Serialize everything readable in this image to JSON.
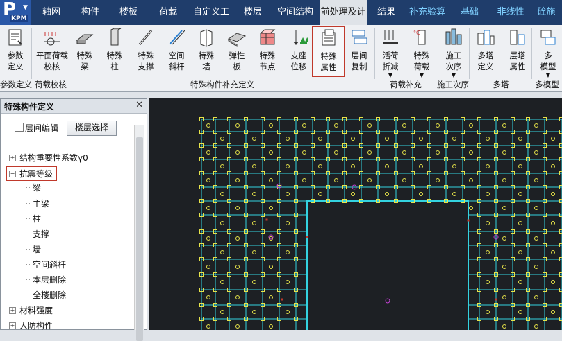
{
  "app": {
    "logo_letter": "P",
    "logo_text": "KPM",
    "logo_menu_icon": "dropdown-arrow-icon"
  },
  "menubar": {
    "items": [
      {
        "label": "轴网"
      },
      {
        "label": "构件"
      },
      {
        "label": "楼板"
      },
      {
        "label": "荷载"
      },
      {
        "label": "自定义工"
      },
      {
        "label": "楼层"
      },
      {
        "label": "空间结构"
      },
      {
        "label": "前处理及计"
      },
      {
        "label": "结果"
      },
      {
        "label": "补充验算"
      },
      {
        "label": "基础"
      },
      {
        "label": "非线性"
      },
      {
        "label": "砼施"
      }
    ],
    "active_index": 7
  },
  "ribbon": {
    "buttons": [
      {
        "label": "参数\n定义",
        "icon": "document-parameters-icon"
      },
      {
        "label": "平面荷载\n校核",
        "icon": "load-check-icon"
      },
      {
        "label": "特殊\n梁",
        "icon": "special-beam-icon"
      },
      {
        "label": "特殊\n柱",
        "icon": "special-column-icon"
      },
      {
        "label": "特殊\n支撑",
        "icon": "special-brace-icon"
      },
      {
        "label": "空间\n斜杆",
        "icon": "space-diagonal-icon"
      },
      {
        "label": "特殊\n墙",
        "icon": "special-wall-icon"
      },
      {
        "label": "弹性\n板",
        "icon": "elastic-slab-icon"
      },
      {
        "label": "特殊\n节点",
        "icon": "special-node-icon"
      },
      {
        "label": "支座\n位移",
        "icon": "support-displacement-icon"
      },
      {
        "label": "特殊\n属性",
        "icon": "special-property-icon"
      },
      {
        "label": "层间\n复制",
        "icon": "layer-copy-icon"
      },
      {
        "label": "活荷\n折减",
        "icon": "live-load-reduction-icon"
      },
      {
        "label": "特殊\n荷载",
        "icon": "special-load-icon"
      },
      {
        "label": "施工\n次序",
        "icon": "construction-order-icon"
      },
      {
        "label": "多塔\n定义",
        "icon": "multi-tower-define-icon"
      },
      {
        "label": "层塔\n属性",
        "icon": "layer-tower-property-icon"
      },
      {
        "label": "多\n模型",
        "icon": "multi-model-icon"
      }
    ],
    "groups": [
      {
        "label": "参数定义"
      },
      {
        "label": "荷载校核"
      },
      {
        "label": "特殊构件补充定义"
      },
      {
        "label": "荷载补充"
      },
      {
        "label": "施工次序"
      },
      {
        "label": "多塔"
      },
      {
        "label": "多模型"
      }
    ],
    "highlight_index": 10
  },
  "panel": {
    "title": "特殊构件定义",
    "close_icon": "close-icon",
    "checkbox_label": "层间编辑",
    "floor_button": "楼层选择",
    "tree": [
      {
        "label": "结构重要性系数γ0",
        "level": 0,
        "toggle": "+"
      },
      {
        "label": "抗震等级",
        "level": 0,
        "toggle": "-",
        "highlight": true
      },
      {
        "label": "梁",
        "level": 1
      },
      {
        "label": "主梁",
        "level": 1
      },
      {
        "label": "柱",
        "level": 1
      },
      {
        "label": "支撑",
        "level": 1
      },
      {
        "label": "墙",
        "level": 1
      },
      {
        "label": "空间斜杆",
        "level": 1
      },
      {
        "label": "本层删除",
        "level": 1
      },
      {
        "label": "全楼删除",
        "level": 1
      },
      {
        "label": "材料强度",
        "level": 0,
        "toggle": "+"
      },
      {
        "label": "人防构件",
        "level": 0,
        "toggle": "+"
      }
    ]
  },
  "colors": {
    "menubar_bg": "#1f3d6b",
    "ribbon_bg": "#eef0f3",
    "cad_bg": "#1d2024",
    "grid_cyan": "#33d3e0",
    "node_yellow": "#e6e34a",
    "label_magenta": "#c040d0",
    "highlight_red": "#c0392b"
  }
}
